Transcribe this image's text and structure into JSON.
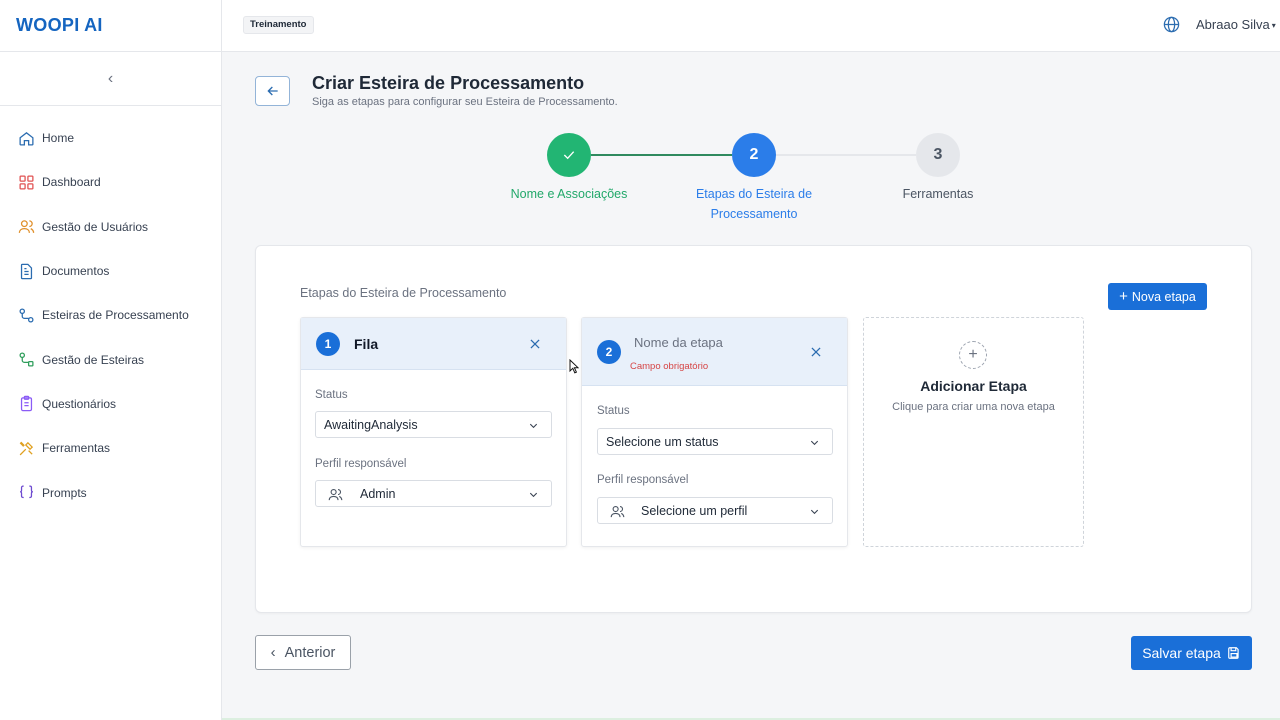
{
  "app": {
    "logo": "WOOPI AI"
  },
  "topbar": {
    "env_badge": "Treinamento",
    "user_name": "Abraao Silva",
    "user_caret": "▾"
  },
  "sidebar": {
    "collapse_glyph": "‹",
    "items": [
      {
        "label": "Home",
        "icon": "home-icon",
        "color": "#2b6cb0"
      },
      {
        "label": "Dashboard",
        "icon": "dashboard-icon",
        "color": "#e05252"
      },
      {
        "label": "Gestão de Usuários",
        "icon": "users-icon",
        "color": "#e0902b"
      },
      {
        "label": "Documentos",
        "icon": "document-icon",
        "color": "#2b6cb0"
      },
      {
        "label": "Esteiras de Processamento",
        "icon": "workflow-icon",
        "color": "#2b6cb0"
      },
      {
        "label": "Gestão de Esteiras",
        "icon": "workflow-manage-icon",
        "color": "#2f9e5b"
      },
      {
        "label": "Questionários",
        "icon": "clipboard-icon",
        "color": "#8b5cf6"
      },
      {
        "label": "Ferramentas",
        "icon": "tools-icon",
        "color": "#e0a020"
      },
      {
        "label": "Prompts",
        "icon": "braces-icon",
        "color": "#6d4ad0"
      }
    ]
  },
  "header": {
    "title": "Criar Esteira de Processamento",
    "subtitle": "Siga as etapas para configurar seu Esteira de Processamento."
  },
  "stepper": {
    "steps": [
      {
        "number": "1",
        "label": "Nome e Associações",
        "state": "completed"
      },
      {
        "number": "2",
        "label_line1": "Etapas do Esteira de",
        "label_line2": "Processamento",
        "state": "active"
      },
      {
        "number": "3",
        "label": "Ferramentas",
        "state": "pending"
      }
    ],
    "colors": {
      "completed": "#22b573",
      "active": "#2b7de9",
      "pending": "#e5e7eb"
    }
  },
  "stages_panel": {
    "title": "Etapas do Esteira de Processamento",
    "new_button": "Nova etapa",
    "new_button_glyph": "+",
    "stages": [
      {
        "number": "1",
        "name": "Fila",
        "status_label": "Status",
        "status_value": "AwaitingAnalysis",
        "profile_label": "Perfil responsável",
        "profile_value": "Admin"
      },
      {
        "number": "2",
        "name_placeholder": "Nome da etapa",
        "error": "Campo obrigatório",
        "status_label": "Status",
        "status_placeholder": "Selecione um status",
        "profile_label": "Perfil responsável",
        "profile_placeholder": "Selecione um perfil"
      }
    ],
    "add_card": {
      "glyph": "+",
      "title": "Adicionar Etapa",
      "subtitle": "Clique para criar uma nova etapa"
    }
  },
  "footer": {
    "prev_glyph": "‹",
    "prev_label": "Anterior",
    "save_label": "Salvar etapa"
  }
}
